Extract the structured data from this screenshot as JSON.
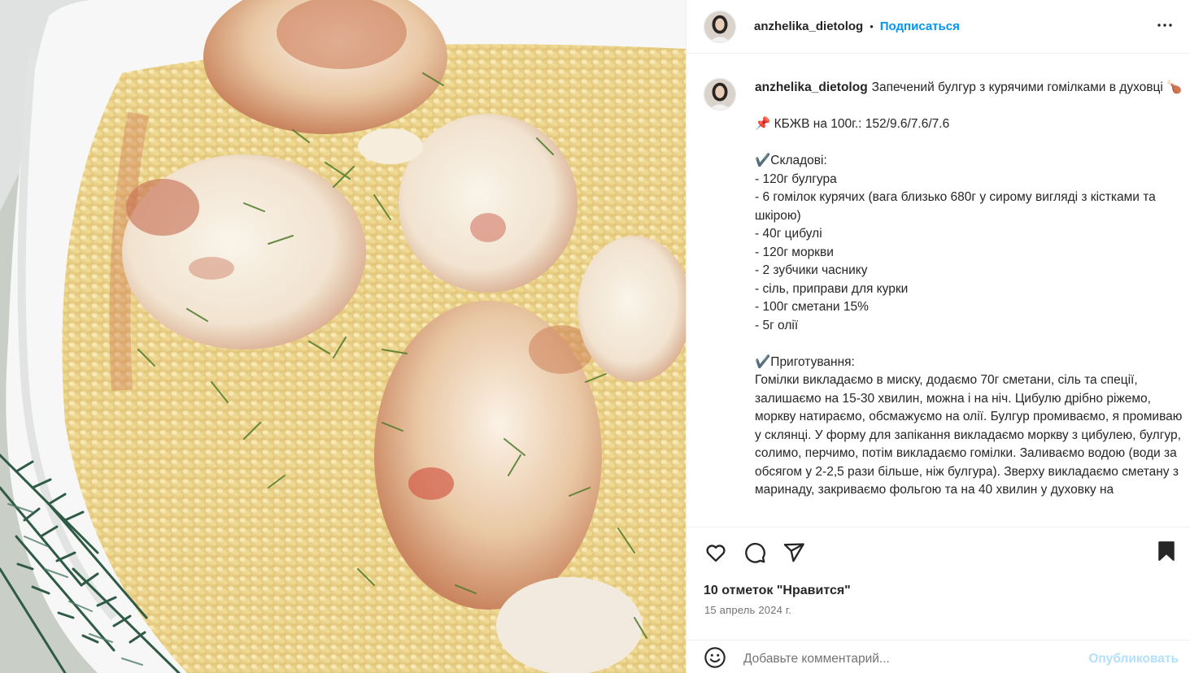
{
  "post": {
    "username": "anzhelika_dietolog",
    "separator": "•",
    "follow_label": "Подписаться",
    "more_icon": "more-horizontal-icon"
  },
  "caption": {
    "username": "anzhelika_dietolog",
    "lines": [
      {
        "text": "Запечений булгур з курячими гомілками в духовці 🍗"
      },
      {
        "text": ""
      },
      {
        "text": "📌 КБЖВ на 100г.: 152/9.6/7.6/7.6"
      },
      {
        "text": ""
      },
      {
        "text": "✔️Складові:"
      },
      {
        "text": "- 120г булгура"
      },
      {
        "text": "- 6 гомілок курячих (вага близько 680г у сирому вигляді з кістками та шкірою)"
      },
      {
        "text": "- 40г цибулі"
      },
      {
        "text": "- 120г моркви"
      },
      {
        "text": "- 2 зубчики часнику"
      },
      {
        "text": "- сіль, приправи для курки"
      },
      {
        "text": "- 100г сметани 15%"
      },
      {
        "text": "- 5г олії"
      },
      {
        "text": ""
      },
      {
        "text": "✔️Приготування:"
      },
      {
        "text": "Гомілки викладаємо в миску, додаємо 70г сметани, сіль та спеції, залишаємо на 15-30 хвилин, можна і на ніч. Цибулю дрібно ріжемо, моркву натираємо, обсмажуємо на олії. Булгур промиваємо, я промиваю у склянці. У форму для запікання викладаємо моркву з цибулею, булгур, солимо, перчимо, потім викладаємо гомілки. Заливаємо водою (води за обсягом у 2-2,5 рази більше, ніж булгура). Зверху викладаємо сметану з маринаду, закриваємо фольгою та на 40 хвилин у духовку на"
      }
    ]
  },
  "actions": {
    "like_icon": "heart-icon",
    "comment_icon": "comment-icon",
    "share_icon": "share-icon",
    "save_icon": "bookmark-icon",
    "likes_text": "10 отметок \"Нравится\"",
    "date_text": "15 апрель 2024 г."
  },
  "comment": {
    "emoji_icon": "emoji-icon",
    "placeholder": "Добавьте комментарий...",
    "publish_label": "Опубликовать"
  },
  "colors": {
    "accent": "#0095f6",
    "publish_disabled": "#b2dffc",
    "muted": "#737373",
    "border": "#efefef",
    "check": "#9b59d0"
  }
}
